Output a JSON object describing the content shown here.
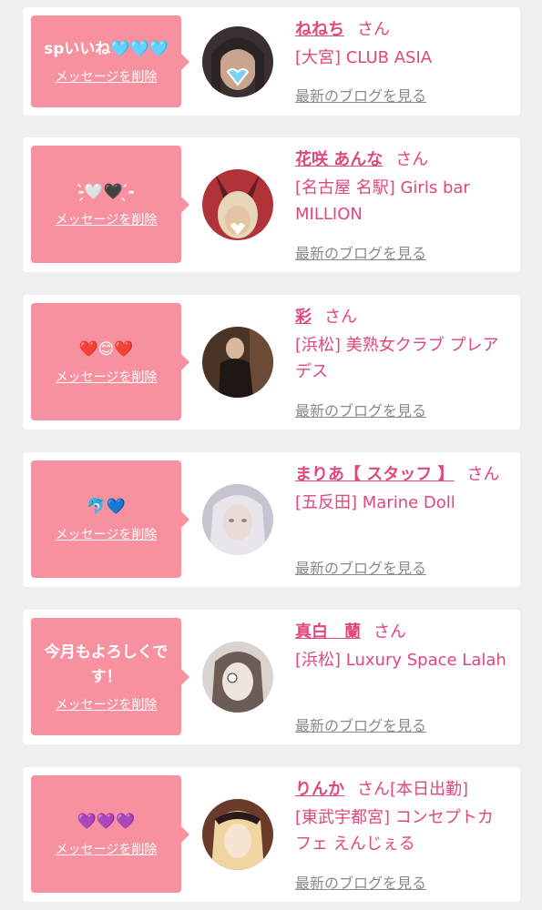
{
  "cards": [
    {
      "message": "spいいね🩵🩵🩵",
      "delete_label": "メッセージを削除",
      "name": "ねねち",
      "honorific": "さん",
      "shop": "[大宮] CLUB ASIA",
      "blog_label": "最新のブログを見る",
      "avatar_colors": [
        "#3a3030",
        "#c9a48f",
        "#2a2424"
      ]
    },
    {
      "message": "-̗̀🤍🖤 ̖́-",
      "delete_label": "メッセージを削除",
      "name": "花咲 あんな",
      "honorific": "さん",
      "shop": "[名古屋 名駅] Girls bar MILLION",
      "blog_label": "最新のブログを見る",
      "avatar_colors": [
        "#b0333a",
        "#e3c4a3",
        "#5e1d22"
      ]
    },
    {
      "message": "❤️😊❤️",
      "delete_label": "メッセージを削除",
      "name": "彩",
      "honorific": "さん",
      "shop": "[浜松] 美熟女クラブ プレアデス",
      "blog_label": "最新のブログを見る",
      "avatar_colors": [
        "#4a3426",
        "#d8b89c",
        "#1e1714"
      ]
    },
    {
      "message": "🐬💙",
      "delete_label": "メッセージを削除",
      "name": "まりあ【 スタッフ 】",
      "honorific": "さん",
      "shop": "[五反田] Marine Doll",
      "blog_label": "最新のブログを見る",
      "avatar_colors": [
        "#c9c3d0",
        "#eadbd6",
        "#8b8494"
      ]
    },
    {
      "message": "今月もよろしくです！",
      "delete_label": "メッセージを削除",
      "name": "真白　蘭",
      "honorific": "さん",
      "shop": "[浜松] Luxury Space Lalah",
      "blog_label": "最新のブログを見る",
      "avatar_colors": [
        "#6b5d55",
        "#efe5dc",
        "#3a322e"
      ]
    },
    {
      "message": "💜💜💜",
      "delete_label": "メッセージを削除",
      "name": "りんか",
      "honorific": "さん[本日出勤]",
      "shop": "[東武宇都宮] コンセプトカフェ えんじぇる",
      "blog_label": "最新のブログを見る",
      "avatar_colors": [
        "#6a3b2b",
        "#f0d5a0",
        "#2a1b1a"
      ]
    }
  ]
}
